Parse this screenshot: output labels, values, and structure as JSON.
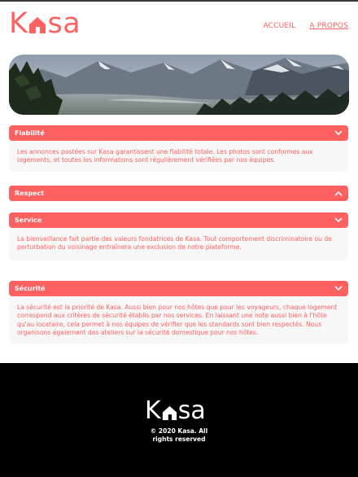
{
  "header": {
    "logo_text": "Kasa",
    "nav": [
      {
        "label": "ACCUEIL",
        "active": false
      },
      {
        "label": "A PROPOS",
        "active": true
      }
    ]
  },
  "banner": {
    "alt": "Mountain landscape"
  },
  "accordion": [
    {
      "title": "Fiabilité",
      "expanded": true,
      "chevron": "chevron-down-icon",
      "text": "Les annonces postées sur Kasa garantissent une fiabilité totale. Les photos sont conformes aux logements, et toutes les informations sont régulièrement vérifiées par nos équipes."
    },
    {
      "title": "Respect",
      "expanded": false,
      "chevron": "chevron-up-icon",
      "text": ""
    },
    {
      "title": "Service",
      "expanded": true,
      "chevron": "chevron-down-icon",
      "text": "La bienveillance fait partie des valeurs fondatrices de Kasa. Tout comportement discriminatoire ou de perturbation du voisinage entraînera une exclusion de notre plateforme."
    },
    {
      "title": "Sécurité",
      "expanded": true,
      "chevron": "chevron-down-icon",
      "text": "La sécurité est la priorité de Kasa. Aussi bien pour nos hôtes que pour les voyageurs, chaque logement correspond aux critères de sécurité établis par nos services. En laissant une note aussi bien à l'hôte qu'au locataire, cela permet à nos équipes de vérifier que les standards sont bien respectés. Nous organisons également des ateliers sur la sécurité domestique pour nos hôtes."
    }
  ],
  "footer": {
    "logo_text": "Kasa",
    "copyright_line1": "© 2020 Kasa. All",
    "copyright_line2": "rights reserved"
  },
  "colors": {
    "accent": "#FF6060",
    "panel": "#F7F7F7",
    "footer": "#000000"
  }
}
